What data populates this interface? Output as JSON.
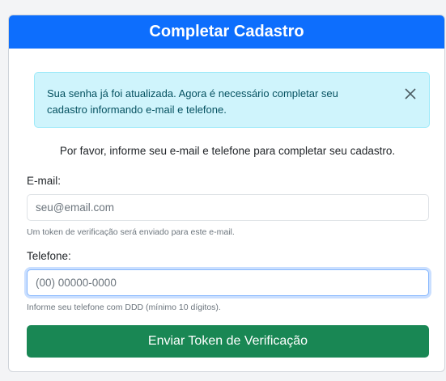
{
  "header": {
    "title": "Completar Cadastro"
  },
  "alert": {
    "message": "Sua senha já foi atualizada. Agora é necessário completar seu cadastro informando e-mail e telefone.",
    "close_icon": "close-icon"
  },
  "intro": "Por favor, informe seu e-mail e telefone para completar seu cadastro.",
  "email": {
    "label": "E-mail:",
    "placeholder": "seu@email.com",
    "value": "",
    "help": "Um token de verificação será enviado para este e-mail."
  },
  "phone": {
    "label": "Telefone:",
    "placeholder": "(00) 00000-0000",
    "value": "",
    "help": "Informe seu telefone com DDD (mínimo 10 dígitos)."
  },
  "submit": {
    "label": "Enviar Token de Verificação"
  },
  "colors": {
    "header": "#0d6efd",
    "alert_bg": "#cff4fc",
    "alert_text": "#055160",
    "button": "#198754"
  }
}
